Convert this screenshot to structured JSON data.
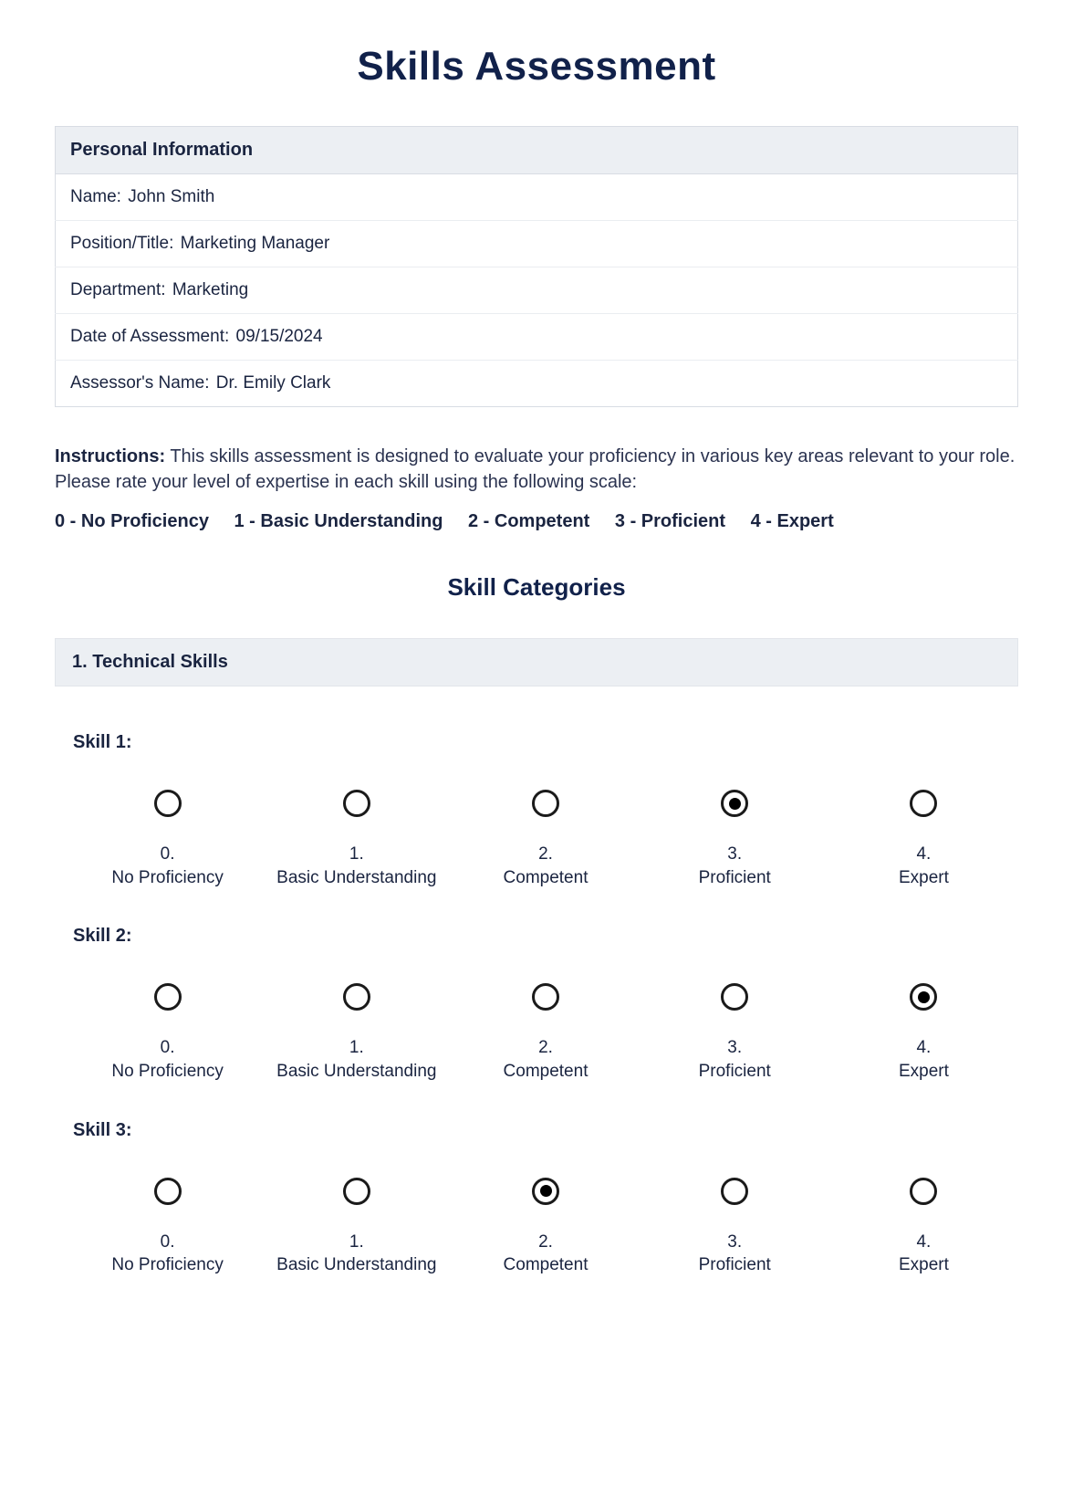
{
  "title": "Skills Assessment",
  "personal_info": {
    "header": "Personal Information",
    "rows": [
      {
        "label": "Name:",
        "value": "John Smith"
      },
      {
        "label": "Position/Title:",
        "value": "Marketing Manager"
      },
      {
        "label": "Department:",
        "value": "Marketing"
      },
      {
        "label": "Date of Assessment:",
        "value": "09/15/2024"
      },
      {
        "label": "Assessor's Name:",
        "value": "Dr. Emily Clark"
      }
    ]
  },
  "instructions_label": "Instructions:",
  "instructions_text": " This skills assessment is designed to evaluate your proficiency in various key areas relevant to your role. Please rate your level of expertise in each skill using the following scale:",
  "scale_items": [
    "0 - No Proficiency",
    "1 - Basic Understanding",
    "2 - Competent",
    "3 - Proficient",
    "4 - Expert"
  ],
  "categories_title": "Skill Categories",
  "category": {
    "header": "1. Technical Skills",
    "ratings": [
      {
        "num": "0.",
        "text": "No Proficiency"
      },
      {
        "num": "1.",
        "text": "Basic Understanding"
      },
      {
        "num": "2.",
        "text": "Competent"
      },
      {
        "num": "3.",
        "text": "Proficient"
      },
      {
        "num": "4.",
        "text": "Expert"
      }
    ],
    "skills": [
      {
        "label": "Skill 1:",
        "selected": 3
      },
      {
        "label": "Skill 2:",
        "selected": 4
      },
      {
        "label": "Skill 3:",
        "selected": 2
      }
    ]
  }
}
